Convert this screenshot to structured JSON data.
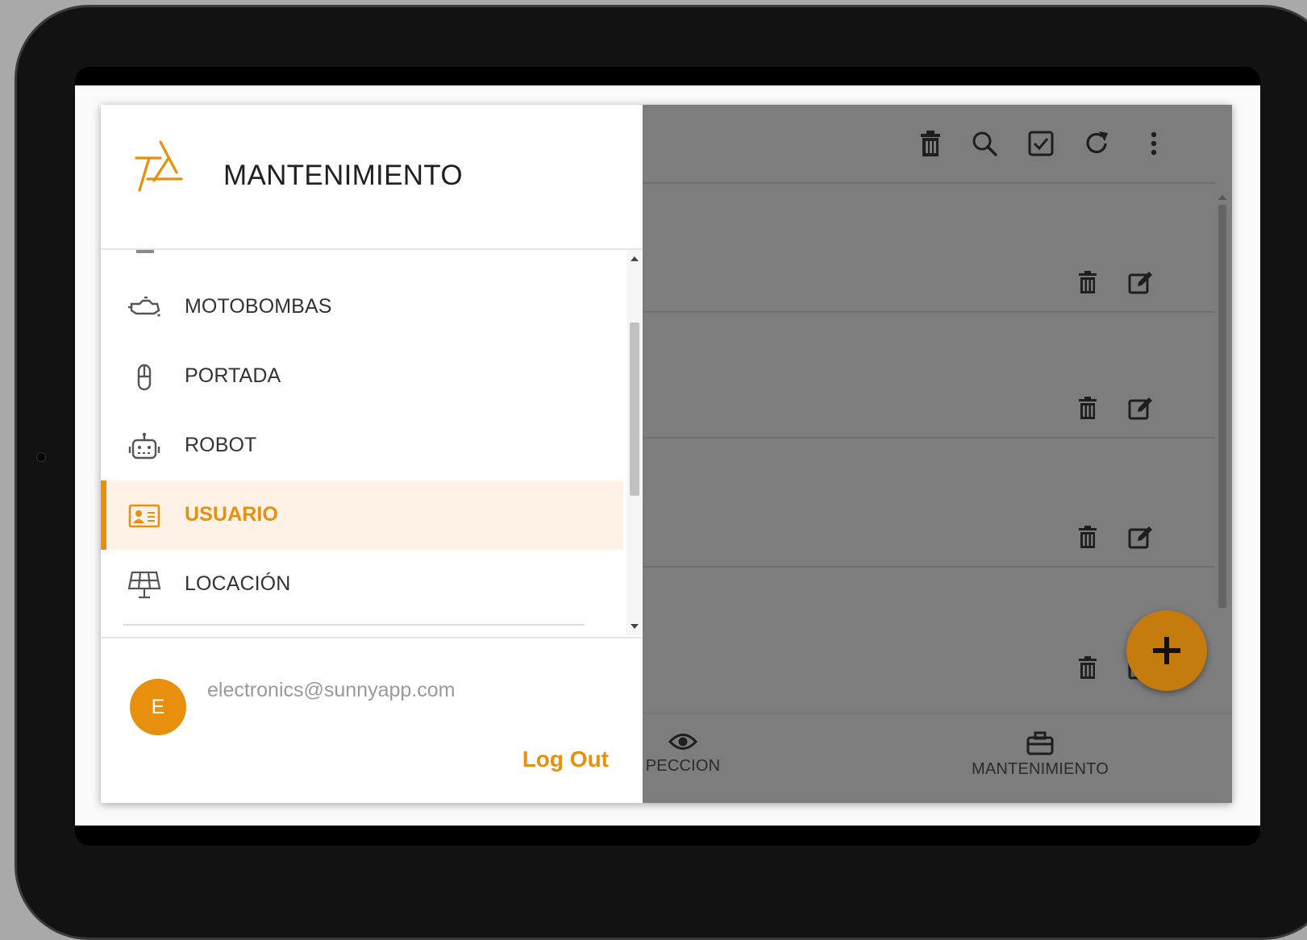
{
  "drawer": {
    "title": "MANTENIMIENTO",
    "logo_icon": "sunny-logo-icon",
    "items": [
      {
        "label": "MOTOBOMBAS",
        "icon": "motor-pump-icon",
        "active": false
      },
      {
        "label": "PORTADA",
        "icon": "gate-icon",
        "active": false
      },
      {
        "label": "ROBOT",
        "icon": "robot-icon",
        "active": false
      },
      {
        "label": "USUARIO",
        "icon": "user-id-card-icon",
        "active": true
      },
      {
        "label": "LOCACIÓN",
        "icon": "solar-panel-icon",
        "active": false
      }
    ],
    "user": {
      "initial": "E",
      "email": "electronics@sunnyapp.com"
    },
    "logout_label": "Log Out"
  },
  "toolbar": {
    "icons": [
      "trash-icon",
      "search-icon",
      "checkbox-icon",
      "refresh-icon",
      "more-vertical-icon"
    ]
  },
  "list": {
    "row_icons": [
      "trash-icon",
      "edit-icon"
    ]
  },
  "bottom_nav": [
    {
      "label": "PECCION",
      "icon": "eye-icon"
    },
    {
      "label": "MANTENIMIENTO",
      "icon": "briefcase-icon"
    }
  ],
  "colors": {
    "accent": "#e8900d",
    "active_bg": "#fdf2e5",
    "overlay": "#7d7d7d"
  }
}
